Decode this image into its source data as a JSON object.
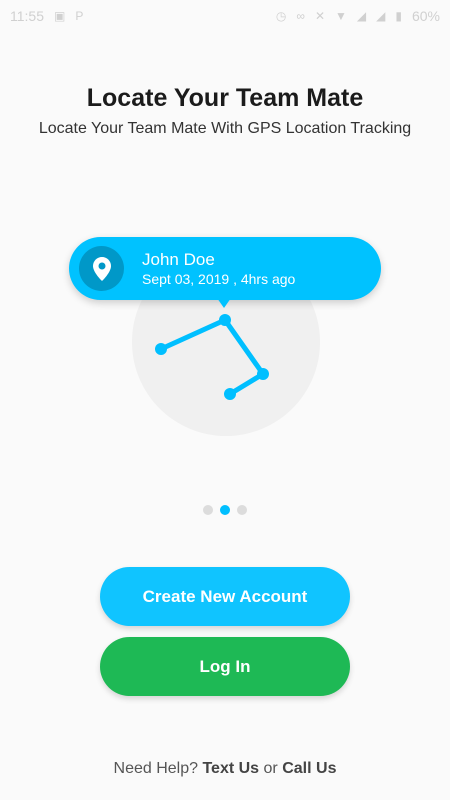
{
  "status_bar": {
    "time": "11:55",
    "battery": "60%"
  },
  "hero": {
    "title": "Locate Your Team Mate",
    "subtitle": "Locate Your Team Mate With GPS Location Tracking"
  },
  "card": {
    "name": "John Doe",
    "time": "Sept 03, 2019 , 4hrs ago"
  },
  "pager": {
    "count": 3,
    "active_index": 1
  },
  "buttons": {
    "create": "Create New Account",
    "login": "Log In"
  },
  "help": {
    "prefix": "Need Help?",
    "text_us": "Text Us",
    "or": "or",
    "call_us": "Call Us"
  },
  "colors": {
    "accent": "#00c2ff",
    "login": "#1eb955"
  }
}
